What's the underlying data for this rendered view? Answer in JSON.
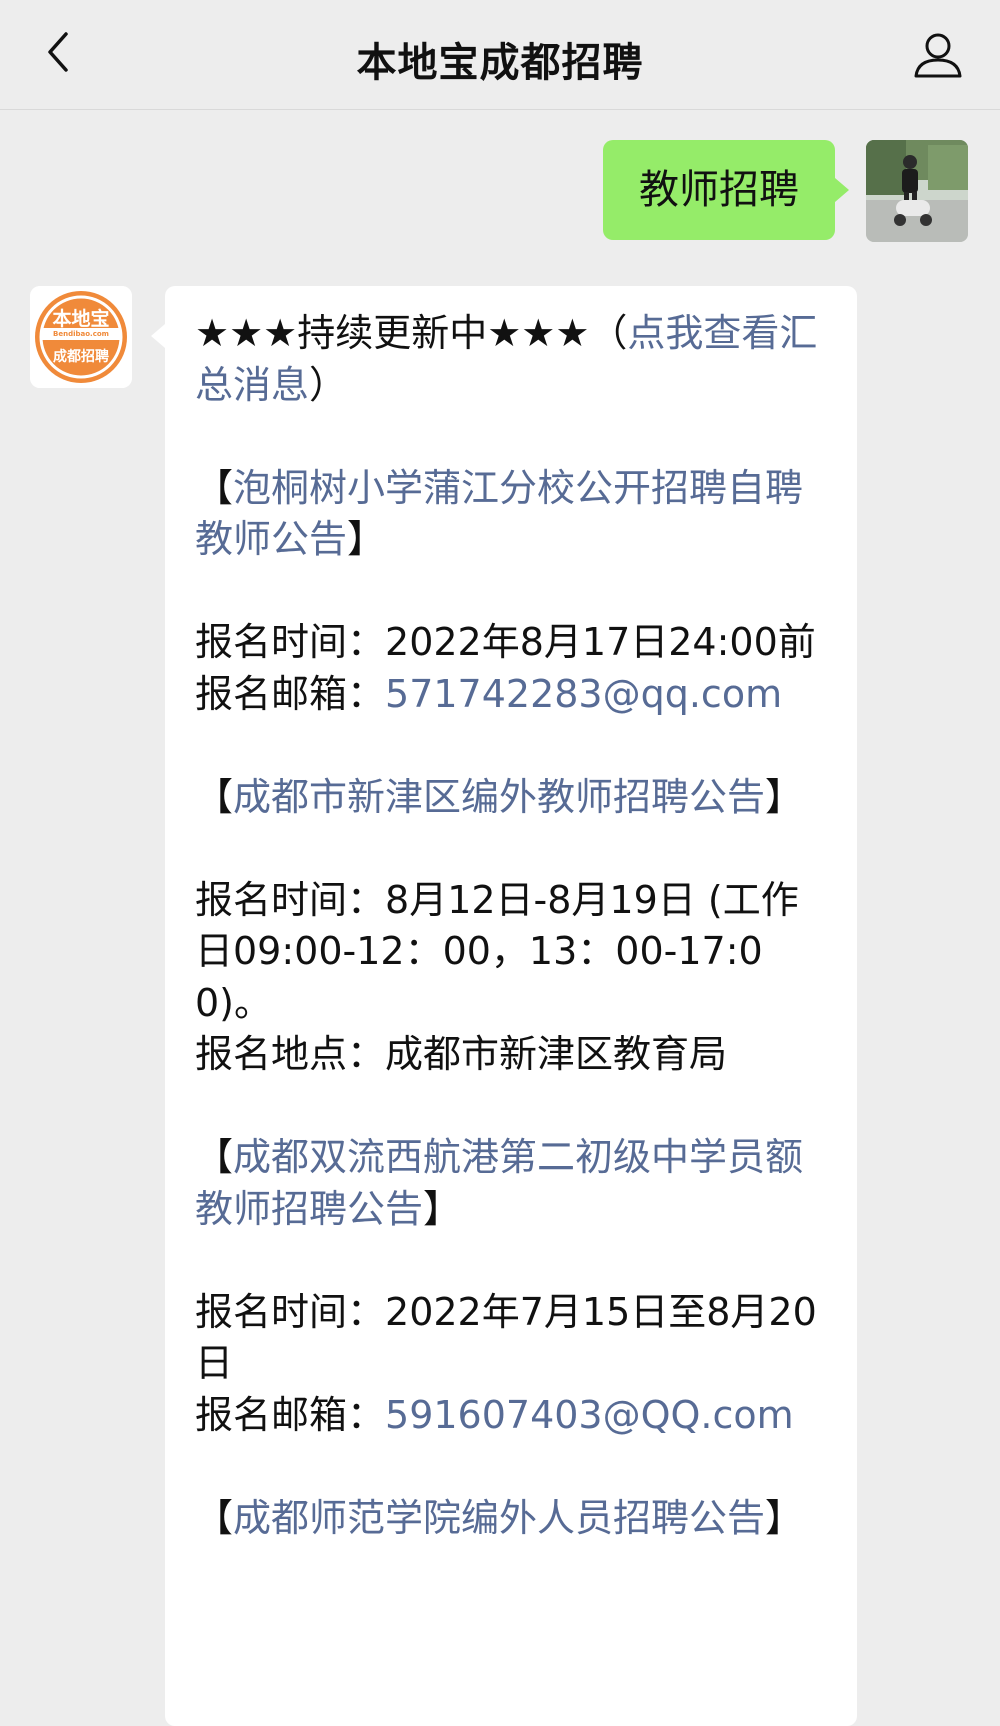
{
  "header": {
    "title": "本地宝成都招聘",
    "back_icon": "chevron-left-icon",
    "profile_icon": "person-icon"
  },
  "outgoing": {
    "text": "教师招聘",
    "bubble_color": "#95ec69"
  },
  "bot": {
    "avatar_logo_text": "本地宝",
    "avatar_domain_text": "Bendibao.com",
    "avatar_sub_text": "成都招聘",
    "brand_color": "#f08a3a"
  },
  "message": {
    "intro_plain": "★★★持续更新中★★★（",
    "intro_link": "点我查看汇总消息",
    "intro_close": "）",
    "items": [
      {
        "open": "【",
        "title": "泡桐树小学蒲江分校公开招聘自聘教师公告",
        "close": "】",
        "line1_label": "报名时间：",
        "line1_value": "2022年8月17日24:00前",
        "line2_label": "报名邮箱：",
        "line2_value": "571742283@qq.com"
      },
      {
        "open": "【",
        "title": "成都市新津区编外教师招聘公告",
        "close": "】",
        "line1_label": "报名时间：",
        "line1_value": "8月12日-8月19日 (工作日09:00-12：00，13：00-17:00)。",
        "line2_label": "报名地点：",
        "line2_value": "成都市新津区教育局"
      },
      {
        "open": "【",
        "title": "成都双流西航港第二初级中学员额教师招聘公告",
        "close": "】",
        "line1_label": "报名时间：",
        "line1_value": "2022年7月15日至8月20日",
        "line2_label": "报名邮箱：",
        "line2_value": "591607403@QQ.com"
      },
      {
        "open": "【",
        "title": "成都师范学院编外人员招聘公告",
        "close": "】"
      }
    ]
  },
  "colors": {
    "background": "#ededed",
    "link": "#576b95",
    "bubble_in": "#ffffff"
  }
}
